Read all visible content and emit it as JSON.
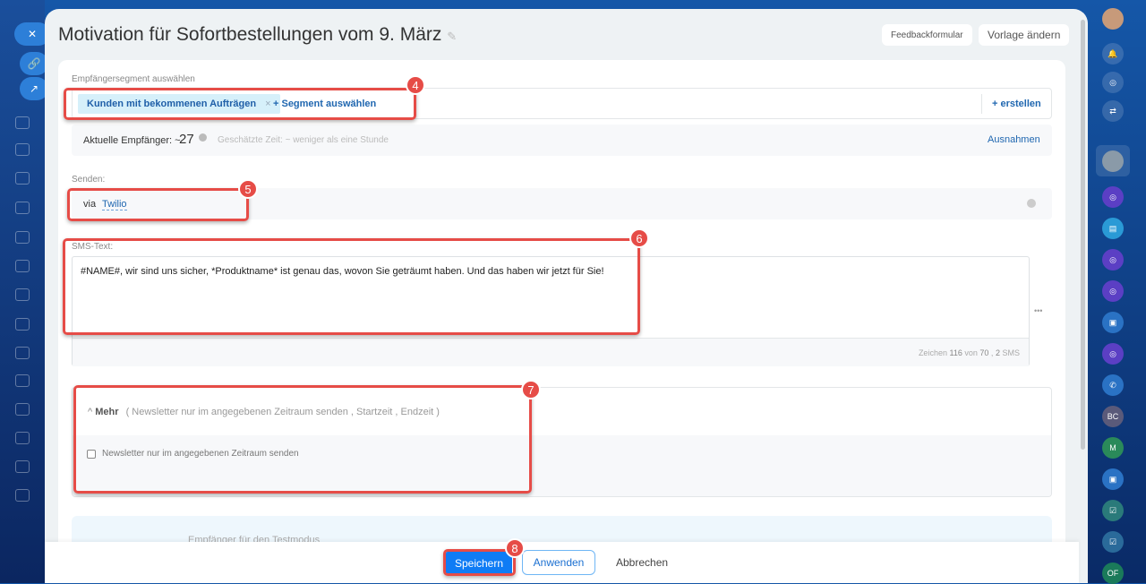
{
  "header": {
    "title": "Motivation für Sofortbestellungen vom 9. März",
    "feedback": "Feedbackformular",
    "change_template": "Vorlage ändern"
  },
  "segment": {
    "label": "Empfängersegment auswählen",
    "tag": "Kunden mit bekommenen Aufträgen",
    "select": "+ Segment auswählen",
    "create": "+ erstellen"
  },
  "recipients": {
    "label": "Aktuelle Empfänger: ~",
    "count": "27",
    "estimate": "Geschätzte Zeit: ~ weniger als eine Stunde",
    "exceptions": "Ausnahmen"
  },
  "send": {
    "label": "Senden:",
    "via": "via",
    "provider": "Twilio"
  },
  "sms": {
    "label": "SMS-Text:",
    "text": "#NAME#, wir sind uns sicher, *Produktname* ist genau das, wovon Sie geträumt haben. Und das haben wir jetzt für Sie!",
    "counter_prefix": "Zeichen",
    "count": "116",
    "von": "von",
    "limit": "70",
    "sep": ",",
    "sms_count": "2",
    "sms": "SMS",
    "more": "•••"
  },
  "more": {
    "title": "Mehr",
    "summary": "( Newsletter nur im angegebenen Zeitraum senden ,  Startzeit ,  Endzeit  )",
    "checkbox": "Newsletter nur im angegebenen Zeitraum senden"
  },
  "test": {
    "label": "Empfänger für den Testmodus"
  },
  "footer": {
    "save": "Speichern",
    "apply": "Anwenden",
    "cancel": "Abbrechen"
  },
  "badges": [
    "4",
    "5",
    "6",
    "7",
    "8"
  ],
  "rail": {
    "bc": "BC",
    "m": "M",
    "of": "OF"
  }
}
